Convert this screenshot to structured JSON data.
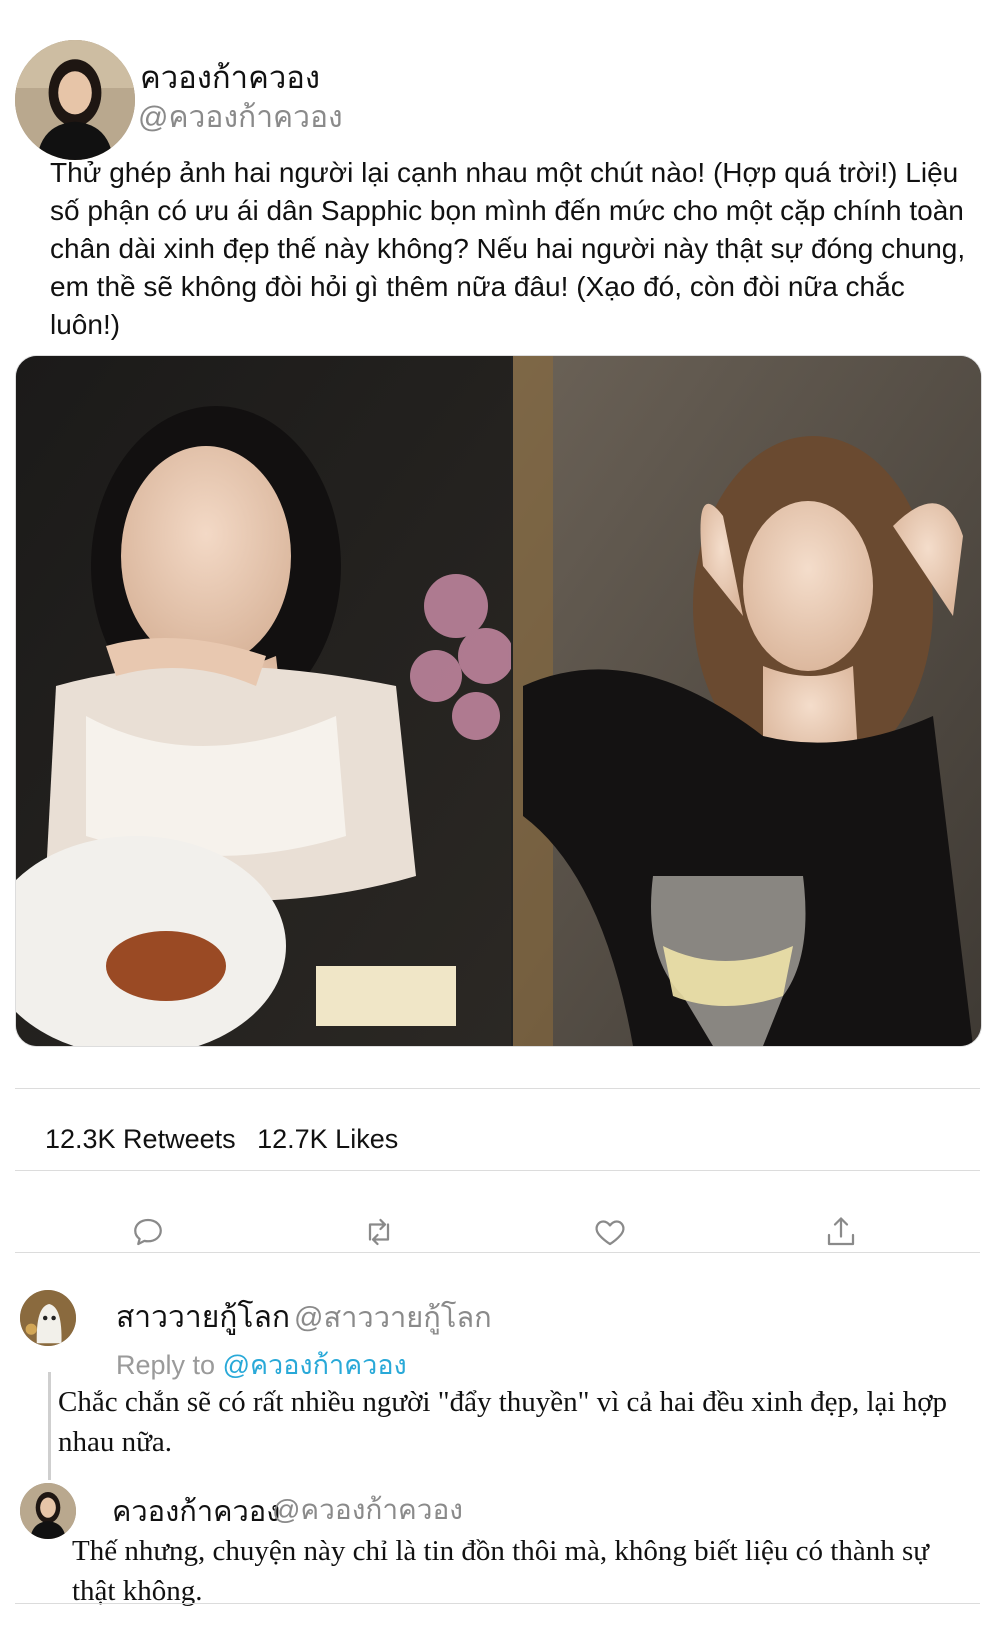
{
  "tweet": {
    "author_name": "ควองก้าควอง",
    "author_handle": "@ควองก้าควอง",
    "text": "Thử ghép ảnh hai người lại cạnh nhau một chút nào! (Hợp quá trời!) Liệu số phận có ưu ái dân Sapphic bọn mình đến mức cho một cặp chính toàn chân dài xinh đẹp thế này không? Nếu hai người này thật sự đóng chung, em thề sẽ không đòi hỏi gì thêm nữa đâu! (Xạo đó, còn đòi nữa chắc luôn!)",
    "media": [
      "woman-white-dress-photo",
      "woman-black-top-photo"
    ]
  },
  "stats": {
    "retweets": "12.3K Retweets",
    "likes": "12.7K Likes"
  },
  "actions": [
    "reply-icon",
    "retweet-icon",
    "like-icon",
    "share-icon"
  ],
  "replies": [
    {
      "author_name": "สาววายกู้โลก",
      "author_handle": "@สาววายกู้โลก",
      "reply_to_label": "Reply to",
      "reply_to_handle": "@ควองก้าควอง",
      "text": "Chắc chắn sẽ có rất nhiều người \"đẩy thuyền\" vì cả hai đều xinh đẹp, lại hợp nhau nữa."
    },
    {
      "author_name": "ควองก้าควอง",
      "author_handle": "@ควองก้าควอง",
      "text": "Thế nhưng, chuyện này chỉ là tin đồn thôi mà, không biết liệu có thành sự thật không."
    }
  ]
}
